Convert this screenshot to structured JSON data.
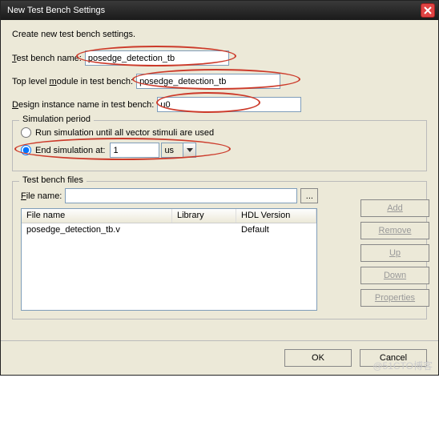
{
  "title": "New Test Bench Settings",
  "desc": "Create new test bench settings.",
  "labels": {
    "tbname_pre": "T",
    "tbname_rest": "est bench name:",
    "topmod_pre": "Top level ",
    "topmod_u": "m",
    "topmod_rest": "odule in test bench:",
    "design_pre": "D",
    "design_rest": "esign instance name in test bench:"
  },
  "fields": {
    "tbname": "posedge_detection_tb",
    "topmod": "posedge_detection_tb",
    "design": "u0"
  },
  "sim": {
    "legend": "Simulation period",
    "runall": "Run simulation until all vector stimuli are used",
    "endat": "End simulation at:",
    "endval": "1",
    "unit": "us"
  },
  "files": {
    "legend": "Test bench files",
    "fname_pre": "F",
    "fname_rest": "ile name:",
    "col_fn": "File name",
    "col_lib": "Library",
    "col_hdl": "HDL Version",
    "row_fn": "posedge_detection_tb.v",
    "row_hdl": "Default"
  },
  "btns": {
    "add": "Add",
    "remove": "Remove",
    "up": "Up",
    "down": "Down",
    "props": "Properties",
    "ok": "OK",
    "cancel": "Cancel",
    "browse": "..."
  },
  "watermark": "@51CTO博客"
}
